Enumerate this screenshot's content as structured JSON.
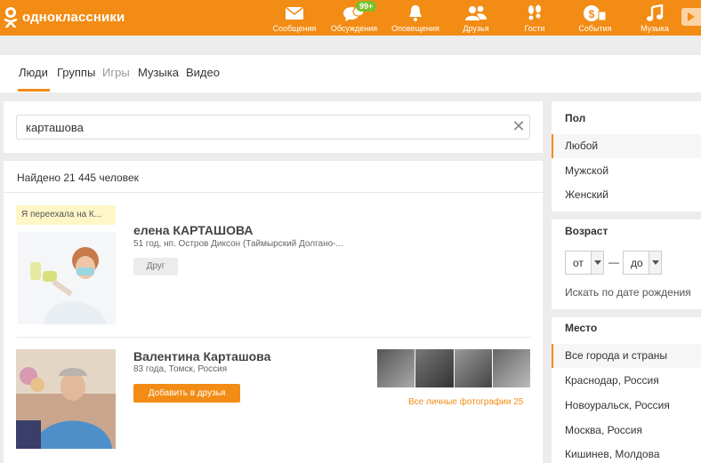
{
  "header": {
    "logo_text": "одноклассники",
    "nav": [
      {
        "icon": "envelope-icon",
        "label": "Сообщения"
      },
      {
        "icon": "discussions-icon",
        "label": "Обсуждения",
        "badge": "99+"
      },
      {
        "icon": "bell-icon",
        "label": "Оповещения"
      },
      {
        "icon": "friends-icon",
        "label": "Друзья"
      },
      {
        "icon": "footprints-icon",
        "label": "Гости"
      },
      {
        "icon": "events-icon",
        "label": "События"
      },
      {
        "icon": "music-note-icon",
        "label": "Музыка"
      }
    ],
    "colors": {
      "brand": "#f28c15",
      "badge": "#7bbf2a"
    }
  },
  "tabs": [
    {
      "label": "Люди",
      "active": true
    },
    {
      "label": "Группы"
    },
    {
      "label": "Игры",
      "disabled": true
    },
    {
      "label": "Музыка"
    },
    {
      "label": "Видео"
    }
  ],
  "search": {
    "value": "карташова"
  },
  "results": {
    "count_text": "Найдено 21 445 человек",
    "people": [
      {
        "status": "Я переехала на К...",
        "name": "елена КАРТАШОВА",
        "meta": "51 год, нп. Остров Диксон (Таймырский Долгано-...",
        "action": "Друг"
      },
      {
        "name": "Валентина Карташова",
        "meta": "83 года, Томск, Россия",
        "action": "Добавить в друзья",
        "photos_link": "Все личные фотографии 25"
      }
    ]
  },
  "filters": {
    "gender": {
      "title": "Пол",
      "options": [
        "Любой",
        "Мужской",
        "Женский"
      ],
      "selected": "Любой"
    },
    "age": {
      "title": "Возраст",
      "from": "от",
      "dash": "—",
      "to": "до",
      "birthdate_link": "Искать по дате рождения"
    },
    "place": {
      "title": "Место",
      "options": [
        "Все города и страны",
        "Краснодар, Россия",
        "Новоуральск, Россия",
        "Москва, Россия",
        "Кишинев, Молдова"
      ],
      "selected": "Все города и страны"
    }
  }
}
